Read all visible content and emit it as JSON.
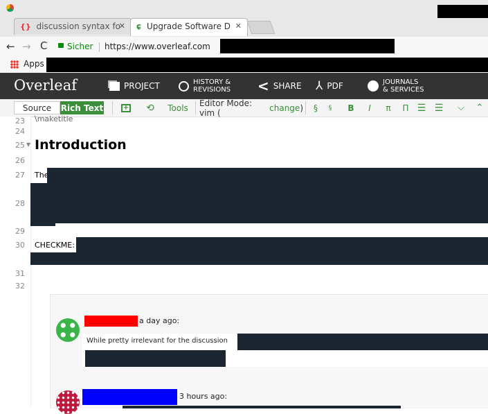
{
  "browser": {
    "tabs": [
      {
        "label": "discussion syntax fo",
        "icon": "code-braces-icon"
      },
      {
        "label": "Upgrade Software D",
        "icon": "overleaf-leaf-icon"
      }
    ],
    "secure_label": "Sicher",
    "url": "https://www.overleaf.com",
    "bookmarks_label": "Apps"
  },
  "overleaf": {
    "logo": "Overleaf",
    "nav": {
      "project": "PROJECT",
      "history_line1": "HISTORY &",
      "history_line2": "REVISIONS",
      "share": "SHARE",
      "pdf": "PDF",
      "journals_line1": "JOURNALS",
      "journals_line2": "& SERVICES"
    },
    "toolbar": {
      "source": "Source",
      "rich_text": "Rich Text",
      "tools": "Tools",
      "editor_mode_prefix": "Editor Mode: vim (",
      "editor_mode_link": "change",
      "editor_mode_suffix": ")",
      "section": "§",
      "subsection": "§",
      "bold": "B",
      "italic": "I",
      "pi_lower": "π",
      "pi_upper": "Π"
    }
  },
  "editor": {
    "lines": [
      {
        "n": "23",
        "text": "\\maketitle"
      },
      {
        "n": "24",
        "text": ""
      },
      {
        "n": "25",
        "text": "Introduction",
        "heading": true
      },
      {
        "n": "26",
        "text": ""
      },
      {
        "n": "27",
        "text": "The"
      },
      {
        "n": "28",
        "text": ""
      },
      {
        "n": "29",
        "text": ""
      },
      {
        "n": "30",
        "text": "CHECKME:"
      },
      {
        "n": "31",
        "text": ""
      },
      {
        "n": "32",
        "text": ""
      }
    ]
  },
  "comments": [
    {
      "time": "a day ago:",
      "text": "While pretty irrelevant for the discussion",
      "name_color": "#ff0000",
      "avatar_color": "#3ab54a"
    },
    {
      "time": "3 hours ago:",
      "name_color": "#0000ff",
      "avatar_color": "#c0183c"
    }
  ]
}
